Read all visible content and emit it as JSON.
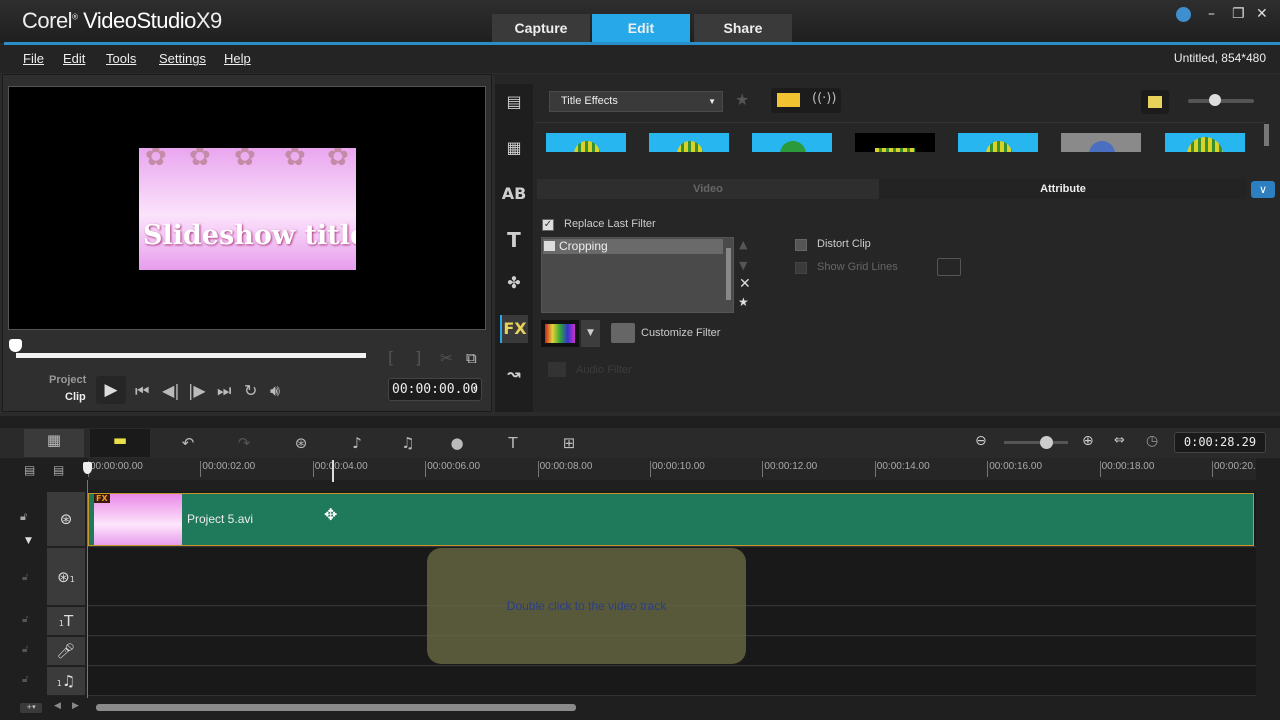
{
  "app": {
    "brand": "Corel",
    "product": "VideoStudio",
    "version": "X9"
  },
  "main_tabs": [
    {
      "label": "Capture",
      "active": false
    },
    {
      "label": "Edit",
      "active": true
    },
    {
      "label": "Share",
      "active": false
    }
  ],
  "window_controls": {
    "help": "help-icon",
    "minimize": "–",
    "restore": "❐",
    "close": "✕"
  },
  "menu": [
    "File",
    "Edit",
    "Tools",
    "Settings",
    "Help"
  ],
  "project_info": "Untitled, 854*480",
  "preview": {
    "title_text": "Slideshow title",
    "mode_project": "Project",
    "mode_clip": "Clip",
    "timecode": "00:00:00.00",
    "progress": 0
  },
  "library": {
    "dropdown": "Title Effects",
    "thumbnail_count": 7,
    "tabs": [
      "Video",
      "Attribute"
    ],
    "active_tab": "Attribute"
  },
  "attribute": {
    "replace_last_filter": {
      "label": "Replace Last Filter",
      "checked": true
    },
    "filters": [
      "Cropping"
    ],
    "distort_clip": {
      "label": "Distort Clip",
      "checked": false
    },
    "show_grid_lines": {
      "label": "Show Grid Lines",
      "checked": false,
      "enabled": false
    },
    "customize_filter": "Customize Filter",
    "audio_filter": "Audio Filter"
  },
  "timeline": {
    "duration": "0:00:28.29",
    "ruler": [
      "00:00:00.00",
      "00:00:02.00",
      "00:00:04.00",
      "00:00:06.00",
      "00:00:08.00",
      "00:00:10.00",
      "00:00:12.00",
      "00:00:14.00",
      "00:00:16.00",
      "00:00:18.00",
      "00:00:20."
    ],
    "clip": {
      "name": "Project 5.avi",
      "badge": "FX"
    },
    "hint": "Double click to the video track",
    "track_numbers": [
      "1",
      "1",
      "1"
    ]
  },
  "colors": {
    "accent": "#27a8e8",
    "clip": "#1f7a5c",
    "clip_border": "#c8962e"
  }
}
